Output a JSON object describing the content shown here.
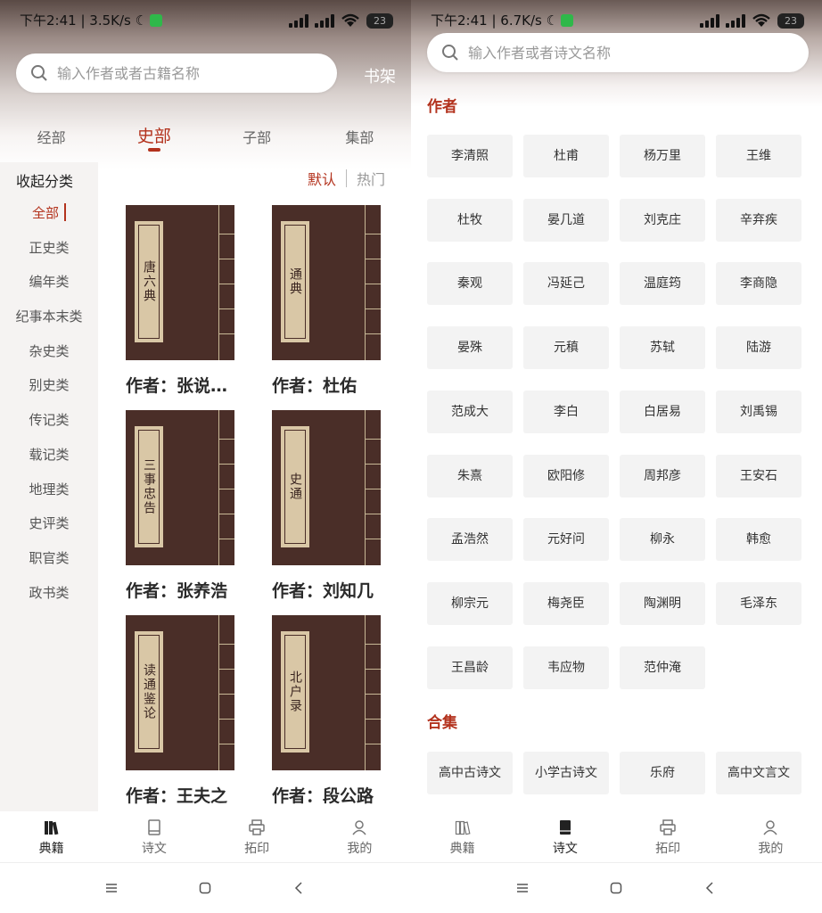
{
  "left": {
    "status": {
      "time": "下午2:41 | 3.5K/s",
      "battery": "23"
    },
    "search": {
      "placeholder": "输入作者或者古籍名称"
    },
    "bookshelf": "书架",
    "category_tabs": [
      {
        "label": "经部",
        "active": false
      },
      {
        "label": "史部",
        "active": true
      },
      {
        "label": "子部",
        "active": false
      },
      {
        "label": "集部",
        "active": false
      }
    ],
    "sidebar": {
      "header": "收起分类",
      "items": [
        "全部",
        "正史类",
        "编年类",
        "纪事本末类",
        "杂史类",
        "别史类",
        "传记类",
        "载记类",
        "地理类",
        "史评类",
        "职官类",
        "政书类"
      ],
      "active_index": 0
    },
    "sort": {
      "default": "默认",
      "popular": "热门"
    },
    "books": [
      {
        "title": "唐六典",
        "author": "作者：张说…"
      },
      {
        "title": "通典",
        "author": "作者：杜佑"
      },
      {
        "title": "三事忠告",
        "author": "作者：张养浩"
      },
      {
        "title": "史通",
        "author": "作者：刘知几"
      },
      {
        "title": "读通鉴论",
        "author": "作者：王夫之"
      },
      {
        "title": "北户录",
        "author": "作者：段公路"
      }
    ],
    "bottom_nav": [
      {
        "label": "典籍",
        "active": true
      },
      {
        "label": "诗文",
        "active": false
      },
      {
        "label": "拓印",
        "active": false
      },
      {
        "label": "我的",
        "active": false
      }
    ]
  },
  "right": {
    "status": {
      "time": "下午2:41 | 6.7K/s",
      "battery": "23"
    },
    "search": {
      "placeholder": "输入作者或者诗文名称"
    },
    "authors_title": "作者",
    "authors": [
      "李清照",
      "杜甫",
      "杨万里",
      "王维",
      "杜牧",
      "晏几道",
      "刘克庄",
      "辛弃疾",
      "秦观",
      "冯延己",
      "温庭筠",
      "李商隐",
      "晏殊",
      "元稹",
      "苏轼",
      "陆游",
      "范成大",
      "李白",
      "白居易",
      "刘禹锡",
      "朱熹",
      "欧阳修",
      "周邦彦",
      "王安石",
      "孟浩然",
      "元好问",
      "柳永",
      "韩愈",
      "柳宗元",
      "梅尧臣",
      "陶渊明",
      "毛泽东",
      "王昌龄",
      "韦应物",
      "范仲淹"
    ],
    "collections_title": "合集",
    "collections": [
      "高中古诗文",
      "小学古诗文",
      "乐府",
      "高中文言文"
    ],
    "bottom_nav": [
      {
        "label": "典籍",
        "active": false
      },
      {
        "label": "诗文",
        "active": true
      },
      {
        "label": "拓印",
        "active": false
      },
      {
        "label": "我的",
        "active": false
      }
    ]
  },
  "colors": {
    "accent": "#b3321d",
    "book_cover": "#4a2e28",
    "book_label": "#d9c7a6",
    "chip_bg": "#f3f3f3"
  },
  "icons": [
    "search-icon",
    "signal-icon",
    "wifi-icon",
    "battery-icon",
    "moon-icon",
    "books-icon",
    "book-icon",
    "printer-icon",
    "user-icon",
    "menu-icon",
    "home-square-icon",
    "back-chevron-icon"
  ]
}
